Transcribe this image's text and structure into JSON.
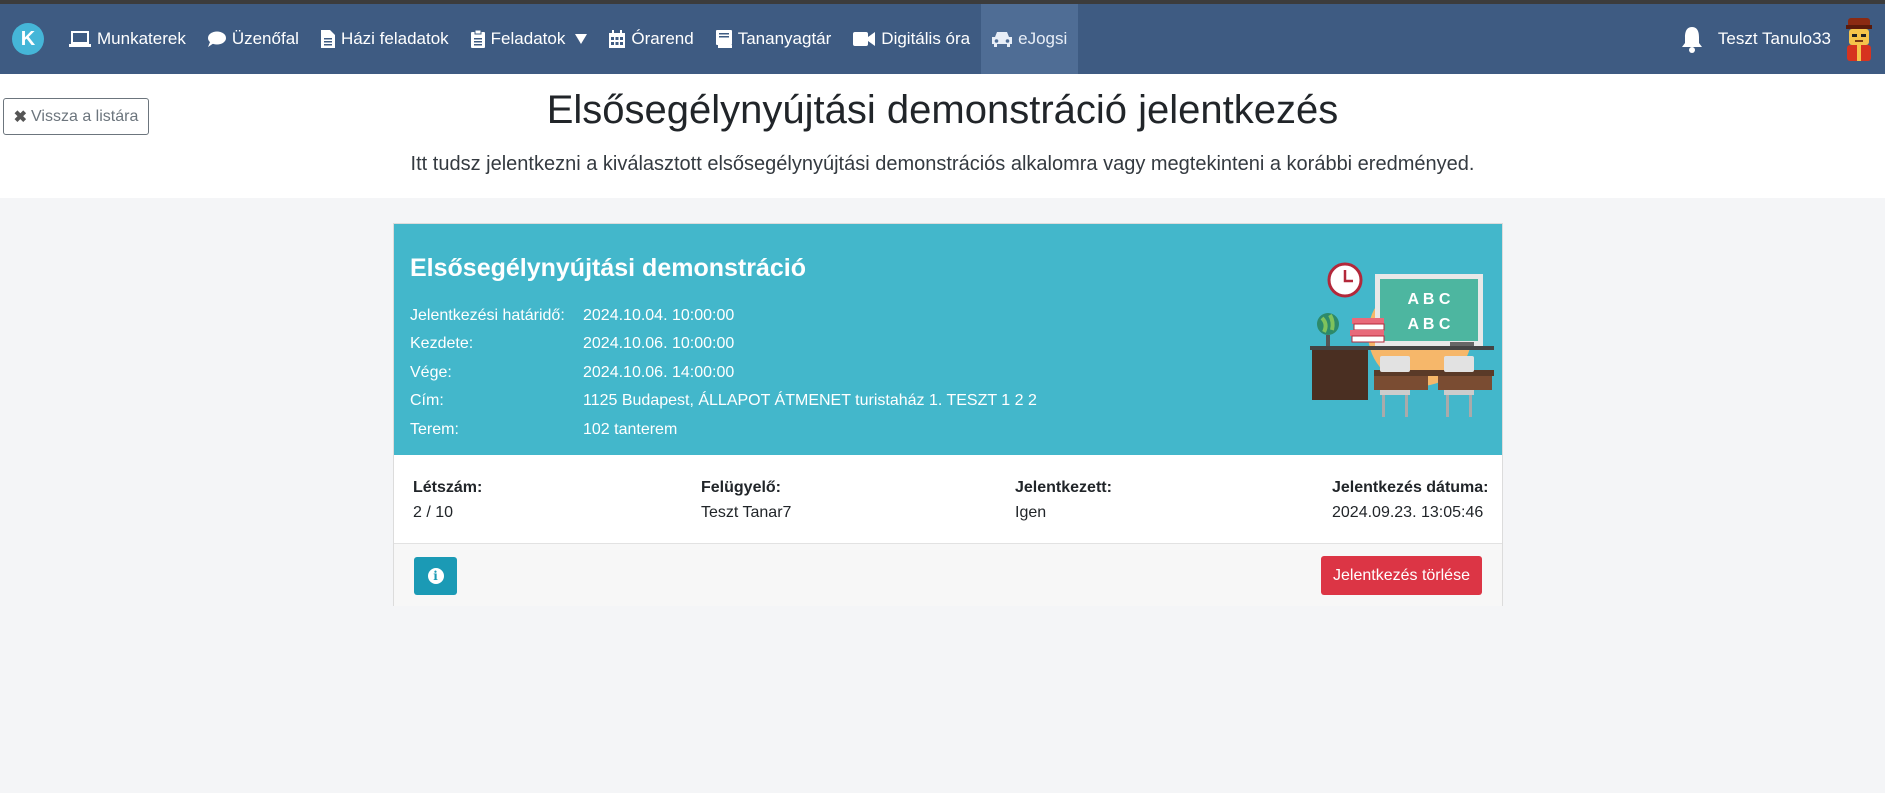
{
  "nav": {
    "logo_letter": "K",
    "items": [
      {
        "label": "Munkaterek",
        "icon": "laptop-icon"
      },
      {
        "label": "Üzenőfal",
        "icon": "comment-icon"
      },
      {
        "label": "Házi feladatok",
        "icon": "file-icon"
      },
      {
        "label": "Feladatok",
        "icon": "clipboard-icon"
      },
      {
        "label": "Órarend",
        "icon": "calendar-icon"
      },
      {
        "label": "Tananyagtár",
        "icon": "book-icon"
      },
      {
        "label": "Digitális óra",
        "icon": "video-icon"
      },
      {
        "label": "eJogsi",
        "icon": "car-icon"
      }
    ],
    "user_name": "Teszt Tanulo33"
  },
  "header": {
    "back_label": "Vissza a listára",
    "title": "Elsősegélynyújtási demonstráció jelentkezés",
    "subtitle": "Itt tudsz jelentkezni a kiválasztott elsősegélynyújtási demonstrációs alkalomra vagy megtekinteni a korábbi eredményed."
  },
  "card": {
    "title": "Elsősegélynyújtási demonstráció",
    "rows": [
      {
        "label": "Jelentkezési határidő:",
        "value": "2024.10.04. 10:00:00"
      },
      {
        "label": "Kezdete:",
        "value": "2024.10.06. 10:00:00"
      },
      {
        "label": "Vége:",
        "value": "2024.10.06. 14:00:00"
      },
      {
        "label": "Cím:",
        "value": "1125 Budapest, ÁLLAPOT ÁTMENET turistaház 1. TESZT 1 2 2"
      },
      {
        "label": "Terem:",
        "value": "102 tanterem"
      }
    ],
    "board_text_1": "A B C",
    "board_text_2": "A B C",
    "stats": [
      {
        "label": "Létszám:",
        "value": "2 / 10"
      },
      {
        "label": "Felügyelő:",
        "value": "Teszt Tanar7"
      },
      {
        "label": "Jelentkezett:",
        "value": "Igen"
      },
      {
        "label": "Jelentkezés dátuma:",
        "value": "2024.09.23. 13:05:46"
      }
    ],
    "delete_label": "Jelentkezés törlése"
  },
  "colors": {
    "navbar": "#3e5b82",
    "card_header": "#43b7cb",
    "danger": "#dc3545",
    "info": "#1b9ab5"
  }
}
